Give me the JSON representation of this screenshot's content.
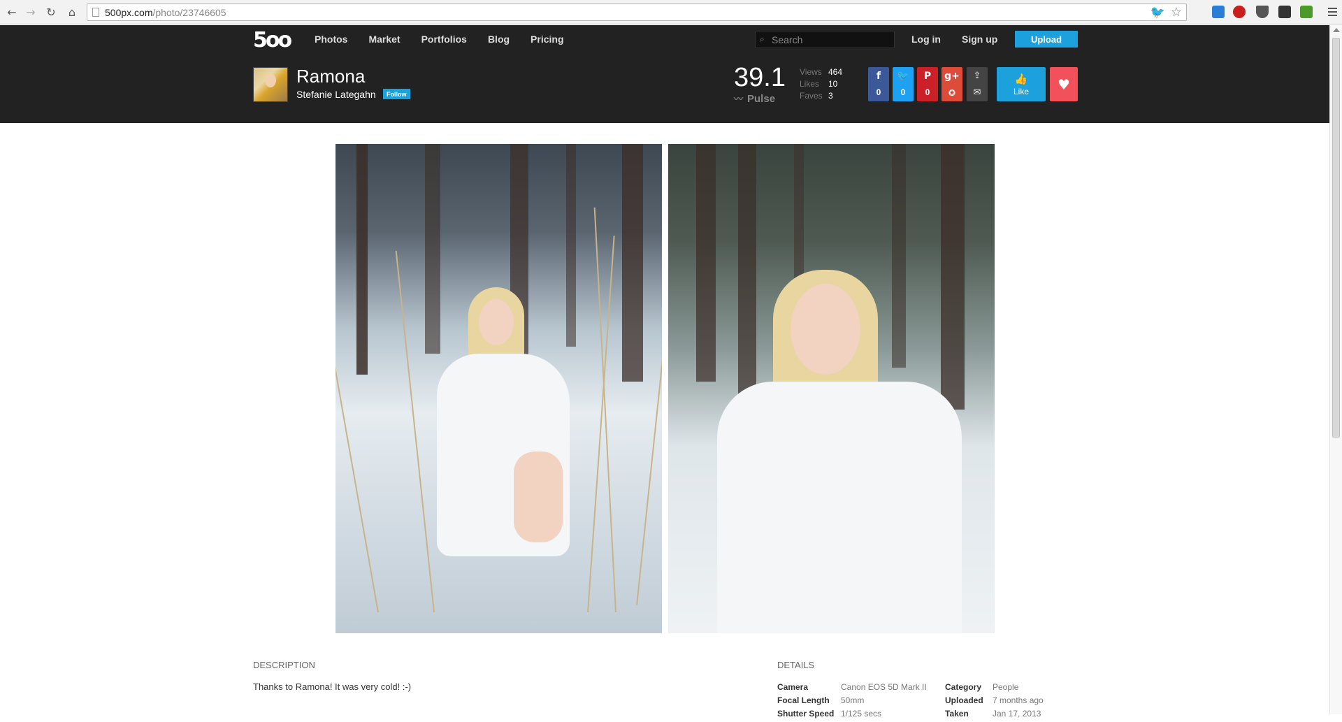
{
  "browser": {
    "url_host": "500px.com",
    "url_path": "/photo/23746605"
  },
  "site": {
    "logo": "5oo",
    "nav": [
      "Photos",
      "Market",
      "Portfolios",
      "Blog",
      "Pricing"
    ],
    "search_placeholder": "Search",
    "login": "Log in",
    "signup": "Sign up",
    "upload": "Upload"
  },
  "photo": {
    "title": "Ramona",
    "author": "Stefanie Lategahn",
    "follow": "Follow",
    "pulse": "39.1",
    "pulse_label": "Pulse",
    "stats": [
      {
        "label": "Views",
        "value": "464"
      },
      {
        "label": "Likes",
        "value": "10"
      },
      {
        "label": "Faves",
        "value": "3"
      }
    ],
    "shares": [
      {
        "network": "facebook",
        "count": "0",
        "color": "#3b5998"
      },
      {
        "network": "twitter",
        "count": "0",
        "color": "#1da1f2"
      },
      {
        "network": "pinterest",
        "count": "0",
        "color": "#cb2027"
      },
      {
        "network": "google-plus",
        "count": "",
        "color": "#dd4b39"
      }
    ],
    "like": "Like"
  },
  "description": {
    "heading": "DESCRIPTION",
    "text": "Thanks to Ramona! It was very cold! :-)"
  },
  "details": {
    "heading": "DETAILS",
    "rows": [
      {
        "k": "Camera",
        "v": "Canon EOS 5D Mark II",
        "k2": "Category",
        "v2": "People"
      },
      {
        "k": "Focal Length",
        "v": "50mm",
        "k2": "Uploaded",
        "v2": "7 months ago"
      },
      {
        "k": "Shutter Speed",
        "v": "1/125 secs",
        "k2": "Taken",
        "v2": "Jan 17, 2013"
      }
    ]
  }
}
